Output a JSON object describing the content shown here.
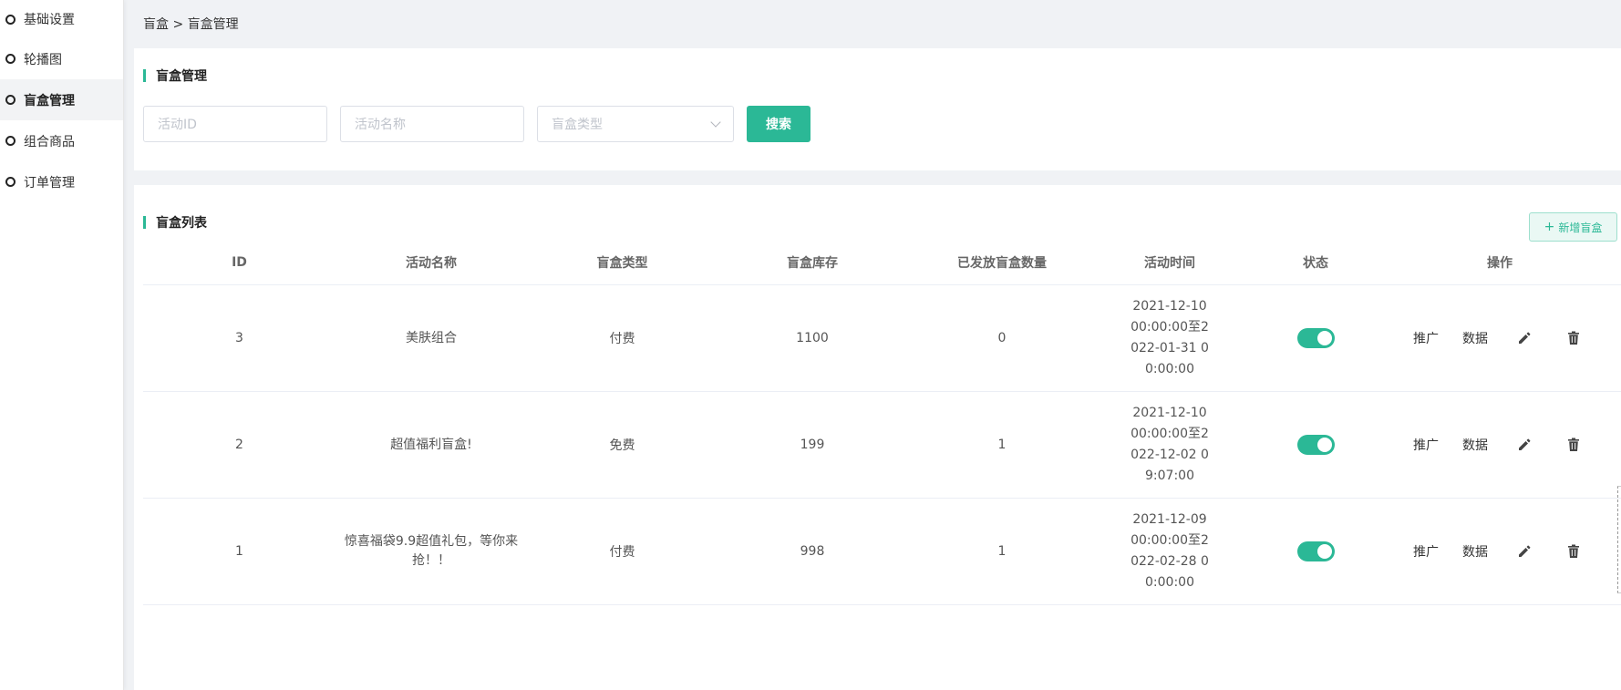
{
  "sidebar": {
    "items": [
      {
        "label": "基础设置"
      },
      {
        "label": "轮播图"
      },
      {
        "label": "盲盒管理"
      },
      {
        "label": "组合商品"
      },
      {
        "label": "订单管理"
      }
    ]
  },
  "breadcrumb": "盲盒 > 盲盒管理",
  "search": {
    "title": "盲盒管理",
    "activity_id_placeholder": "活动ID",
    "activity_name_placeholder": "活动名称",
    "box_type_placeholder": "盲盒类型",
    "search_button": "搜索"
  },
  "list": {
    "title": "盲盒列表",
    "add_button": "新增盲盒",
    "columns": [
      "ID",
      "活动名称",
      "盲盒类型",
      "盲盒库存",
      "已发放盲盒数量",
      "活动时间",
      "状态",
      "操作"
    ],
    "rows": [
      {
        "id": "3",
        "name": "美肤组合",
        "type": "付费",
        "stock": "1100",
        "sent": "0",
        "time": "2021-12-10 00:00:00至2022-01-31 00:00:00",
        "enabled": true
      },
      {
        "id": "2",
        "name": "超值福利盲盒!",
        "type": "免费",
        "stock": "199",
        "sent": "1",
        "time": "2021-12-10 00:00:00至2022-12-02 09:07:00",
        "enabled": true
      },
      {
        "id": "1",
        "name": "惊喜福袋9.9超值礼包，等你来抢！！",
        "type": "付费",
        "stock": "998",
        "sent": "1",
        "time": "2021-12-09 00:00:00至2022-02-28 00:00:00",
        "enabled": true
      }
    ],
    "ops": {
      "promote": "推广",
      "data": "数据"
    }
  },
  "colors": {
    "accent": "#2bb896"
  }
}
